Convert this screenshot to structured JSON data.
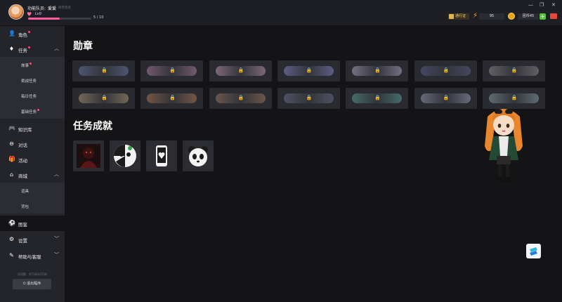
{
  "header": {
    "user_role": "功能队员:",
    "user_name": "爱爱",
    "edit_note": "修改签名",
    "level": "Lv0",
    "xp_text": "5 / 10",
    "xp_fraction": 0.5,
    "pass_label": "通行证",
    "energy": "95",
    "gold": "团币45",
    "plus": "+",
    "window_controls": [
      "—",
      "❐",
      "✕"
    ]
  },
  "sidebar": {
    "items": [
      {
        "label": "角色",
        "icon": "person-icon",
        "dot": true
      },
      {
        "label": "任务",
        "icon": "gem-icon",
        "dot": true,
        "expanded": true
      },
      {
        "label": "故事",
        "sub": true,
        "dot": true
      },
      {
        "label": "挑战任务",
        "sub": true
      },
      {
        "label": "每日任务",
        "sub": true
      },
      {
        "label": "基础任务",
        "sub": true,
        "dot": true
      },
      {
        "label": "知识库",
        "icon": "gamepad-icon"
      },
      {
        "label": "对话",
        "icon": "chat-icon"
      },
      {
        "label": "活动",
        "icon": "gift-icon"
      },
      {
        "label": "商城",
        "icon": "store-icon",
        "expanded": true
      },
      {
        "label": "道具",
        "sub": true
      },
      {
        "label": "背包",
        "sub": true
      },
      {
        "label": "图鉴",
        "icon": "football-icon",
        "active": true
      },
      {
        "label": "设置",
        "icon": "gear-icon"
      },
      {
        "label": "帮助与客服",
        "icon": "help-icon"
      }
    ],
    "qq_text": "QQ群：971842558",
    "logout_label": "退出程序"
  },
  "main": {
    "badges_title": "勋章",
    "achievements_title": "任务成就",
    "badge_lock_icon": "lock-icon",
    "badge_colors": [
      "#6a7aa8",
      "#b07fa0",
      "#c29ab8",
      "#8a84c8",
      "#b0a8c8",
      "#5a5f8a",
      "#8f8c90",
      "#b09a78",
      "#b07850",
      "#a07a60",
      "#6a7090",
      "#5aa09a",
      "#9a9ab8",
      "#8aa0a8"
    ],
    "achievement_icons": [
      "dark-figure-icon",
      "panda-face-icon",
      "phone-heart-icon",
      "panda-icon"
    ]
  }
}
